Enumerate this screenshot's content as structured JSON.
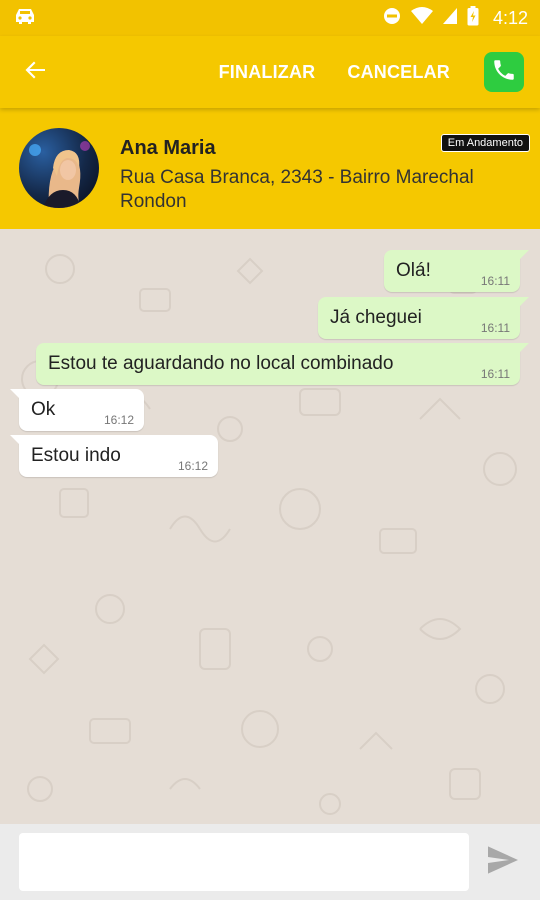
{
  "status_bar": {
    "time": "4:12"
  },
  "toolbar": {
    "finalize_label": "FINALIZAR",
    "cancel_label": "CANCELAR"
  },
  "contact": {
    "name": "Ana Maria",
    "address": "Rua Casa Branca, 2343 - Bairro Marechal Rondon",
    "status": "Em Andamento"
  },
  "messages": [
    {
      "text": "Olá!",
      "time": "16:11",
      "direction": "outgoing"
    },
    {
      "text": "Já cheguei",
      "time": "16:11",
      "direction": "outgoing"
    },
    {
      "text": "Estou te aguardando no local combinado",
      "time": "16:11",
      "direction": "outgoing"
    },
    {
      "text": "Ok",
      "time": "16:12",
      "direction": "incoming"
    },
    {
      "text": "Estou indo",
      "time": "16:12",
      "direction": "incoming"
    }
  ],
  "input": {
    "value": "",
    "placeholder": ""
  },
  "colors": {
    "primary": "#f5c800",
    "status_bar": "#f2c200",
    "outgoing_bubble": "#dcf8c6",
    "incoming_bubble": "#ffffff",
    "chat_background": "#e5ddd5",
    "call_button": "#2ecc40"
  }
}
